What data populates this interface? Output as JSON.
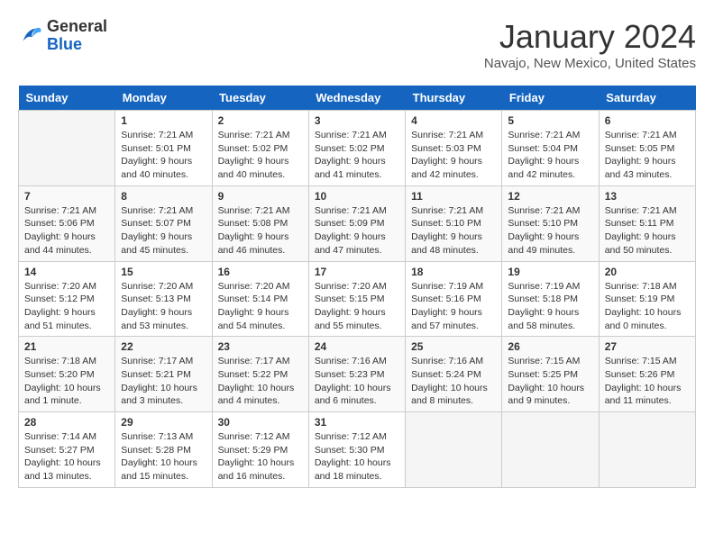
{
  "logo": {
    "general": "General",
    "blue": "Blue"
  },
  "title": "January 2024",
  "location": "Navajo, New Mexico, United States",
  "days_of_week": [
    "Sunday",
    "Monday",
    "Tuesday",
    "Wednesday",
    "Thursday",
    "Friday",
    "Saturday"
  ],
  "weeks": [
    [
      {
        "day": "",
        "info": ""
      },
      {
        "day": "1",
        "info": "Sunrise: 7:21 AM\nSunset: 5:01 PM\nDaylight: 9 hours\nand 40 minutes."
      },
      {
        "day": "2",
        "info": "Sunrise: 7:21 AM\nSunset: 5:02 PM\nDaylight: 9 hours\nand 40 minutes."
      },
      {
        "day": "3",
        "info": "Sunrise: 7:21 AM\nSunset: 5:02 PM\nDaylight: 9 hours\nand 41 minutes."
      },
      {
        "day": "4",
        "info": "Sunrise: 7:21 AM\nSunset: 5:03 PM\nDaylight: 9 hours\nand 42 minutes."
      },
      {
        "day": "5",
        "info": "Sunrise: 7:21 AM\nSunset: 5:04 PM\nDaylight: 9 hours\nand 42 minutes."
      },
      {
        "day": "6",
        "info": "Sunrise: 7:21 AM\nSunset: 5:05 PM\nDaylight: 9 hours\nand 43 minutes."
      }
    ],
    [
      {
        "day": "7",
        "info": "Sunrise: 7:21 AM\nSunset: 5:06 PM\nDaylight: 9 hours\nand 44 minutes."
      },
      {
        "day": "8",
        "info": "Sunrise: 7:21 AM\nSunset: 5:07 PM\nDaylight: 9 hours\nand 45 minutes."
      },
      {
        "day": "9",
        "info": "Sunrise: 7:21 AM\nSunset: 5:08 PM\nDaylight: 9 hours\nand 46 minutes."
      },
      {
        "day": "10",
        "info": "Sunrise: 7:21 AM\nSunset: 5:09 PM\nDaylight: 9 hours\nand 47 minutes."
      },
      {
        "day": "11",
        "info": "Sunrise: 7:21 AM\nSunset: 5:10 PM\nDaylight: 9 hours\nand 48 minutes."
      },
      {
        "day": "12",
        "info": "Sunrise: 7:21 AM\nSunset: 5:10 PM\nDaylight: 9 hours\nand 49 minutes."
      },
      {
        "day": "13",
        "info": "Sunrise: 7:21 AM\nSunset: 5:11 PM\nDaylight: 9 hours\nand 50 minutes."
      }
    ],
    [
      {
        "day": "14",
        "info": "Sunrise: 7:20 AM\nSunset: 5:12 PM\nDaylight: 9 hours\nand 51 minutes."
      },
      {
        "day": "15",
        "info": "Sunrise: 7:20 AM\nSunset: 5:13 PM\nDaylight: 9 hours\nand 53 minutes."
      },
      {
        "day": "16",
        "info": "Sunrise: 7:20 AM\nSunset: 5:14 PM\nDaylight: 9 hours\nand 54 minutes."
      },
      {
        "day": "17",
        "info": "Sunrise: 7:20 AM\nSunset: 5:15 PM\nDaylight: 9 hours\nand 55 minutes."
      },
      {
        "day": "18",
        "info": "Sunrise: 7:19 AM\nSunset: 5:16 PM\nDaylight: 9 hours\nand 57 minutes."
      },
      {
        "day": "19",
        "info": "Sunrise: 7:19 AM\nSunset: 5:18 PM\nDaylight: 9 hours\nand 58 minutes."
      },
      {
        "day": "20",
        "info": "Sunrise: 7:18 AM\nSunset: 5:19 PM\nDaylight: 10 hours\nand 0 minutes."
      }
    ],
    [
      {
        "day": "21",
        "info": "Sunrise: 7:18 AM\nSunset: 5:20 PM\nDaylight: 10 hours\nand 1 minute."
      },
      {
        "day": "22",
        "info": "Sunrise: 7:17 AM\nSunset: 5:21 PM\nDaylight: 10 hours\nand 3 minutes."
      },
      {
        "day": "23",
        "info": "Sunrise: 7:17 AM\nSunset: 5:22 PM\nDaylight: 10 hours\nand 4 minutes."
      },
      {
        "day": "24",
        "info": "Sunrise: 7:16 AM\nSunset: 5:23 PM\nDaylight: 10 hours\nand 6 minutes."
      },
      {
        "day": "25",
        "info": "Sunrise: 7:16 AM\nSunset: 5:24 PM\nDaylight: 10 hours\nand 8 minutes."
      },
      {
        "day": "26",
        "info": "Sunrise: 7:15 AM\nSunset: 5:25 PM\nDaylight: 10 hours\nand 9 minutes."
      },
      {
        "day": "27",
        "info": "Sunrise: 7:15 AM\nSunset: 5:26 PM\nDaylight: 10 hours\nand 11 minutes."
      }
    ],
    [
      {
        "day": "28",
        "info": "Sunrise: 7:14 AM\nSunset: 5:27 PM\nDaylight: 10 hours\nand 13 minutes."
      },
      {
        "day": "29",
        "info": "Sunrise: 7:13 AM\nSunset: 5:28 PM\nDaylight: 10 hours\nand 15 minutes."
      },
      {
        "day": "30",
        "info": "Sunrise: 7:12 AM\nSunset: 5:29 PM\nDaylight: 10 hours\nand 16 minutes."
      },
      {
        "day": "31",
        "info": "Sunrise: 7:12 AM\nSunset: 5:30 PM\nDaylight: 10 hours\nand 18 minutes."
      },
      {
        "day": "",
        "info": ""
      },
      {
        "day": "",
        "info": ""
      },
      {
        "day": "",
        "info": ""
      }
    ]
  ]
}
